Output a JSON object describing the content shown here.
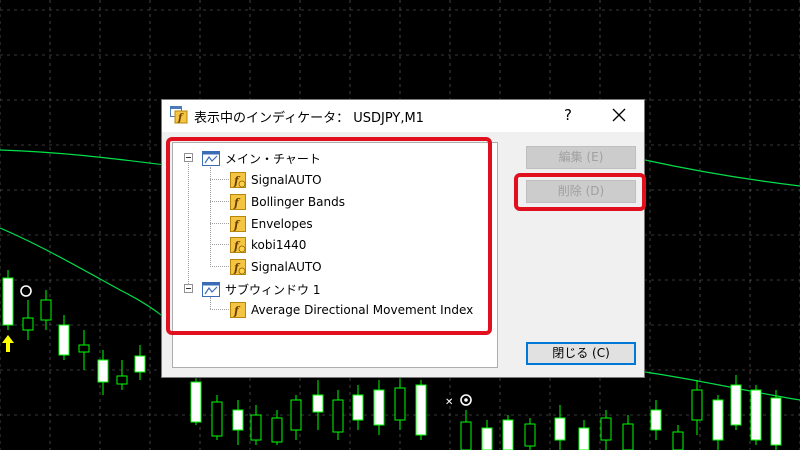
{
  "dialog": {
    "title": "表示中のインディケータ： USDJPY,M1",
    "help_label": "?"
  },
  "tree": {
    "main_window": {
      "label": "メイン・チャート",
      "items": [
        "SignalAUTO",
        "Bollinger Bands",
        "Envelopes",
        "kobi1440",
        "SignalAUTO"
      ]
    },
    "sub_window": {
      "label": "サブウィンドウ 1",
      "items": [
        "Average Directional Movement Index"
      ]
    }
  },
  "buttons": {
    "edit_label": "編集 (E)",
    "delete_label": "削除 (D)",
    "close_label": "閉じる (C)"
  },
  "colors": {
    "chart_background": "#000000",
    "candle_color": "#00ff00",
    "envelope_line": "#00e04a",
    "highlight": "#e0101e",
    "arrow_marker": "#ffff00"
  },
  "icons": {
    "window_icon": "chart-window-icon",
    "indicator_icon": "indicator-f-icon"
  }
}
